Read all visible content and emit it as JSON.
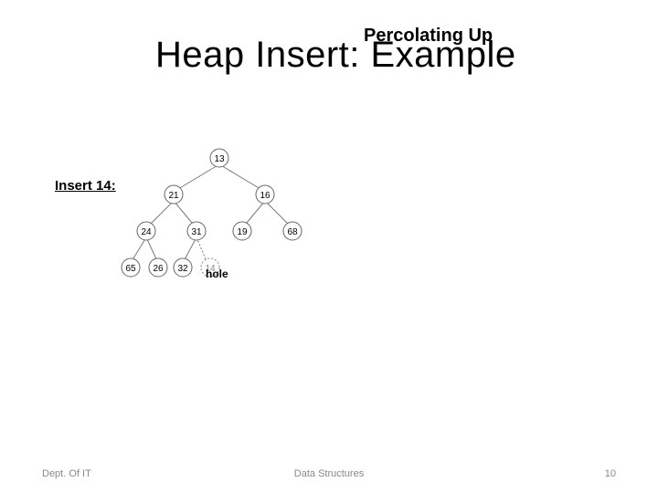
{
  "title": "Heap Insert: Example",
  "annotation_top": "Percolating Up",
  "insert_label": "Insert 14:",
  "hole_label": "hole",
  "tree": {
    "nodes": {
      "root": "13",
      "l": "21",
      "r": "16",
      "ll": "24",
      "lr": "31",
      "rl": "19",
      "rr": "68",
      "lll": "65",
      "llr": "26",
      "lrl": "32",
      "lrr": "14"
    }
  },
  "footer": {
    "left": "Dept. Of  IT",
    "center": "Data Structures",
    "right": "10"
  },
  "chart_data": {
    "type": "diagram",
    "subtype": "binary-heap-tree",
    "title": "Heap Insert: Example — Percolating Up, Insert 14",
    "nodes": [
      {
        "id": 1,
        "value": 13,
        "parent": null
      },
      {
        "id": 2,
        "value": 21,
        "parent": 1
      },
      {
        "id": 3,
        "value": 16,
        "parent": 1
      },
      {
        "id": 4,
        "value": 24,
        "parent": 2
      },
      {
        "id": 5,
        "value": 31,
        "parent": 2
      },
      {
        "id": 6,
        "value": 19,
        "parent": 3
      },
      {
        "id": 7,
        "value": 68,
        "parent": 3
      },
      {
        "id": 8,
        "value": 65,
        "parent": 4
      },
      {
        "id": 9,
        "value": 26,
        "parent": 4
      },
      {
        "id": 10,
        "value": 32,
        "parent": 5
      },
      {
        "id": 11,
        "value": 14,
        "parent": 5,
        "note": "hole (dashed)"
      }
    ]
  }
}
